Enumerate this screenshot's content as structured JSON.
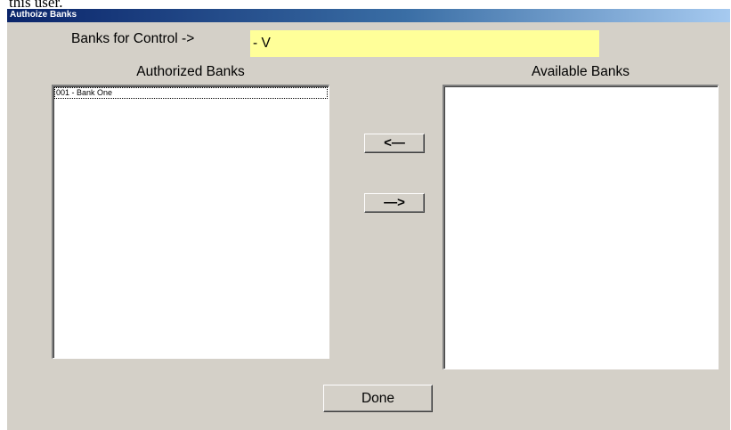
{
  "document_fragment": "this user.",
  "window": {
    "title": "Authoize Banks"
  },
  "control": {
    "label": "Banks for Control ->",
    "value": "- V",
    "field_color": "#ffff99"
  },
  "authorized": {
    "title": "Authorized Banks",
    "items": [
      "001 - Bank One"
    ]
  },
  "available": {
    "title": "Available Banks",
    "items": []
  },
  "buttons": {
    "move_left_label": "<—",
    "move_right_label": "—>",
    "done_label": "Done"
  },
  "colors": {
    "window_background": "#d4d0c8",
    "titlebar_start": "#0a246a",
    "titlebar_end": "#a6caf0"
  }
}
